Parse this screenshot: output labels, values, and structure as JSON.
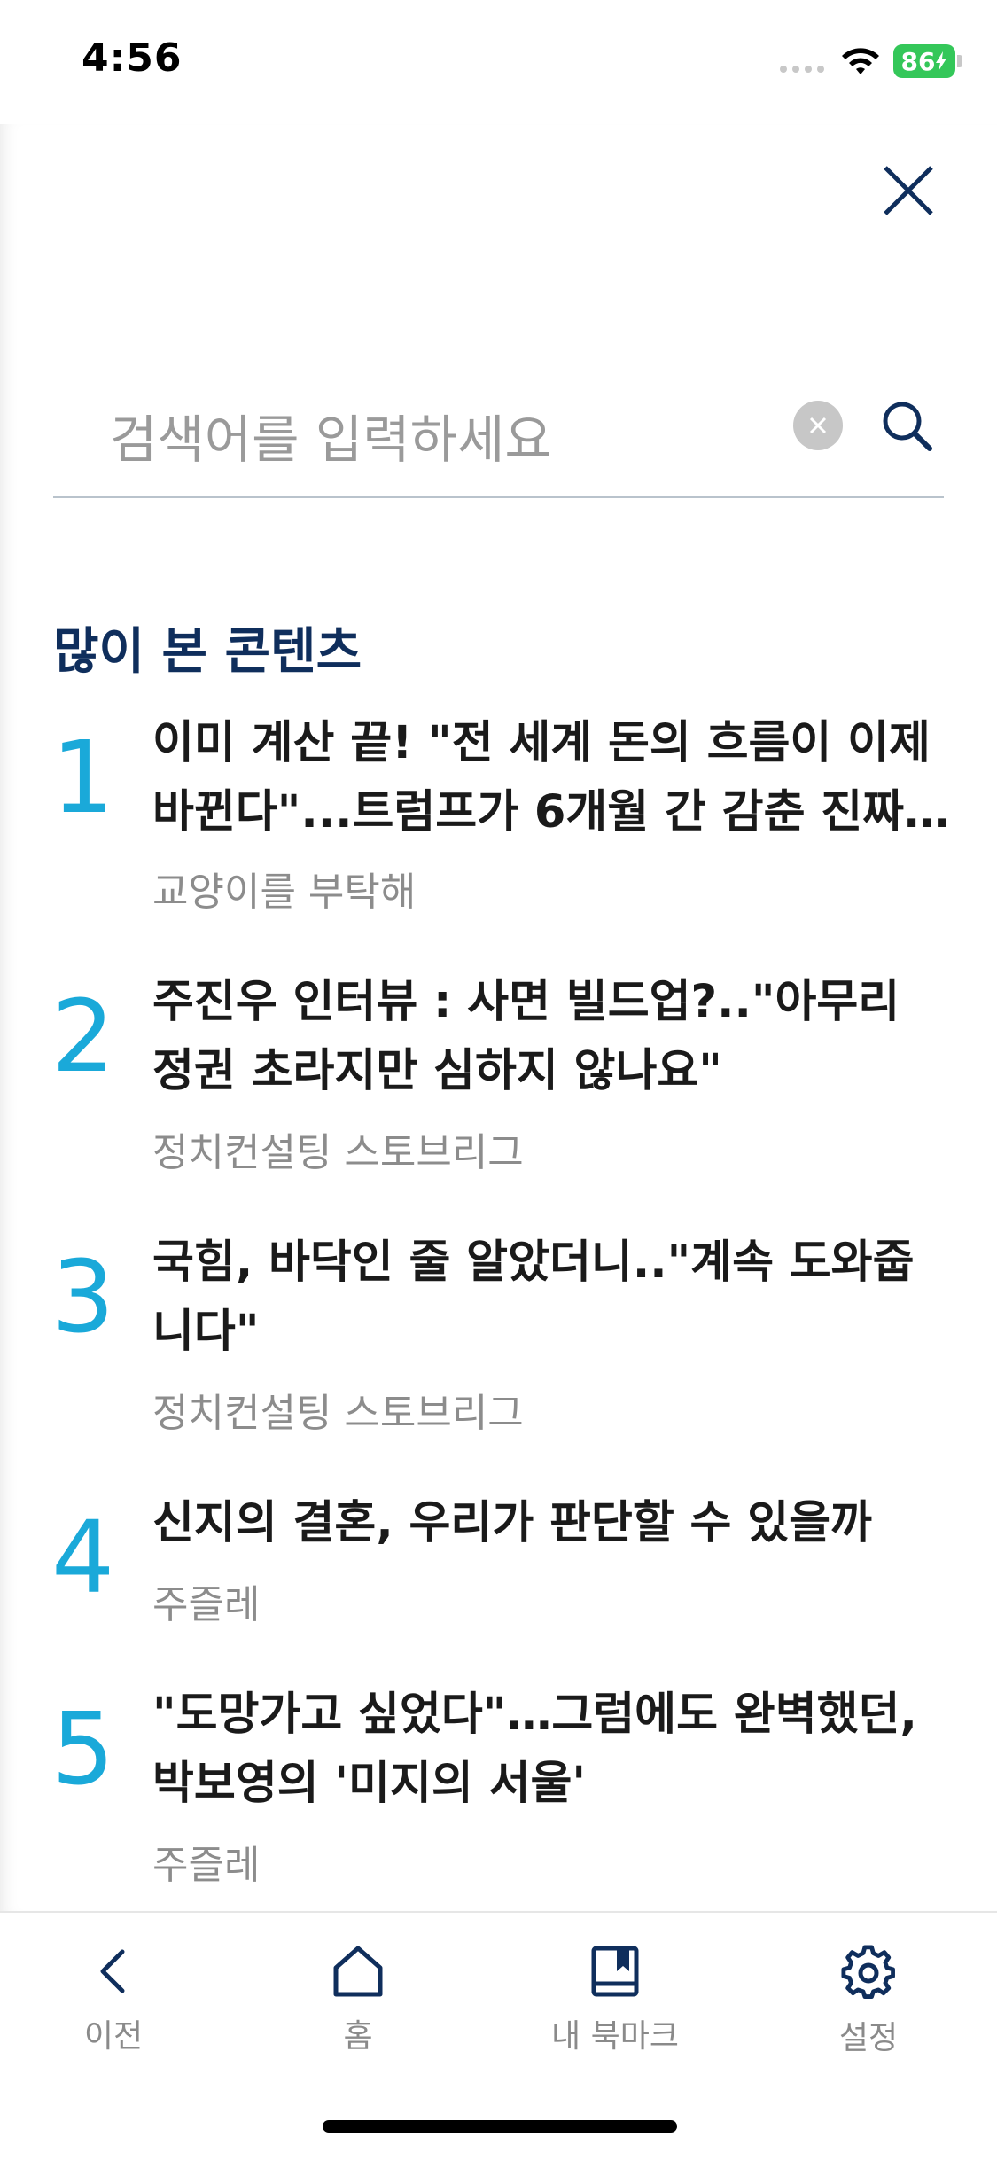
{
  "status": {
    "time": "4:56",
    "battery": "86"
  },
  "search": {
    "placeholder": "검색어를 입력하세요"
  },
  "section_title": "많이 본 콘텐츠",
  "items": [
    {
      "rank": "1",
      "title": "이미 계산 끝! \"전 세계 돈의 흐름이 이제 바뀐다\"...트럼프가 6개월 간 감춘 진짜…",
      "source": "교양이를 부탁해"
    },
    {
      "rank": "2",
      "title": "주진우 인터뷰 : 사면 빌드업?..\"아무리 정권 초라지만 심하지 않나요\"",
      "source": "정치컨설팅 스토브리그"
    },
    {
      "rank": "3",
      "title": "국힘, 바닥인 줄 알았더니..\"계속 도와줍니다\"",
      "source": "정치컨설팅 스토브리그"
    },
    {
      "rank": "4",
      "title": "신지의 결혼, 우리가 판단할 수 있을까",
      "source": "주즐레"
    },
    {
      "rank": "5",
      "title": "\"도망가고 싶었다\"…그럼에도 완벽했던, 박보영의 '미지의 서울'",
      "source": "주즐레"
    }
  ],
  "tabs": [
    {
      "label": "이전",
      "icon": "chevron-left-icon"
    },
    {
      "label": "홈",
      "icon": "home-icon"
    },
    {
      "label": "내 북마크",
      "icon": "bookmark-book-icon"
    },
    {
      "label": "설정",
      "icon": "gear-icon"
    }
  ],
  "colors": {
    "accent": "#1aa9d9",
    "navy": "#0f2e5c",
    "battery": "#34c759"
  }
}
